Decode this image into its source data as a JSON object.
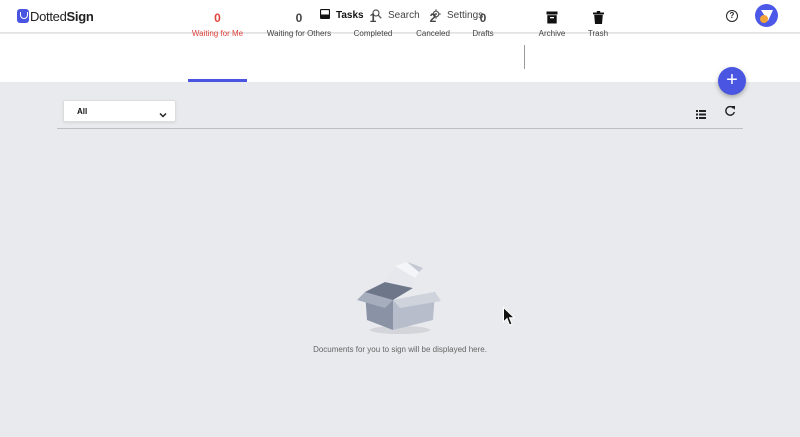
{
  "app": {
    "logo_prefix": "Dotted",
    "logo_suffix": "Sign"
  },
  "nav": {
    "tasks": {
      "label": "Tasks",
      "icon": "inbox-icon"
    },
    "search": {
      "label": "Search",
      "icon": "search-icon"
    },
    "settings": {
      "label": "Settings",
      "icon": "gear-icon"
    }
  },
  "header_actions": {
    "help_icon": "help-circle-icon",
    "help_glyph": "?",
    "avatar": "avatar"
  },
  "tabs": [
    {
      "count": "0",
      "label": "Waiting for Me",
      "active": true
    },
    {
      "count": "0",
      "label": "Waiting for Others",
      "active": false
    },
    {
      "count": "1",
      "label": "Completed",
      "active": false
    },
    {
      "count": "2",
      "label": "Canceled",
      "active": false
    },
    {
      "count": "0",
      "label": "Drafts",
      "active": false
    },
    {
      "icon": "archive-icon",
      "label": "Archive"
    },
    {
      "icon": "trash-icon",
      "label": "Trash"
    }
  ],
  "fab": {
    "glyph": "+",
    "icon": "plus-icon"
  },
  "filter": {
    "selected": "All",
    "icon": "chevron-down-icon"
  },
  "toolbar": {
    "list_icon": "list-view-icon",
    "refresh_icon": "refresh-icon"
  },
  "empty_state": {
    "icon": "open-box-illustration",
    "message": "Documents for you to sign will be displayed here."
  },
  "colors": {
    "accent": "#4a56e2",
    "active_tab": "#e0443e",
    "background": "#e9eaed"
  }
}
